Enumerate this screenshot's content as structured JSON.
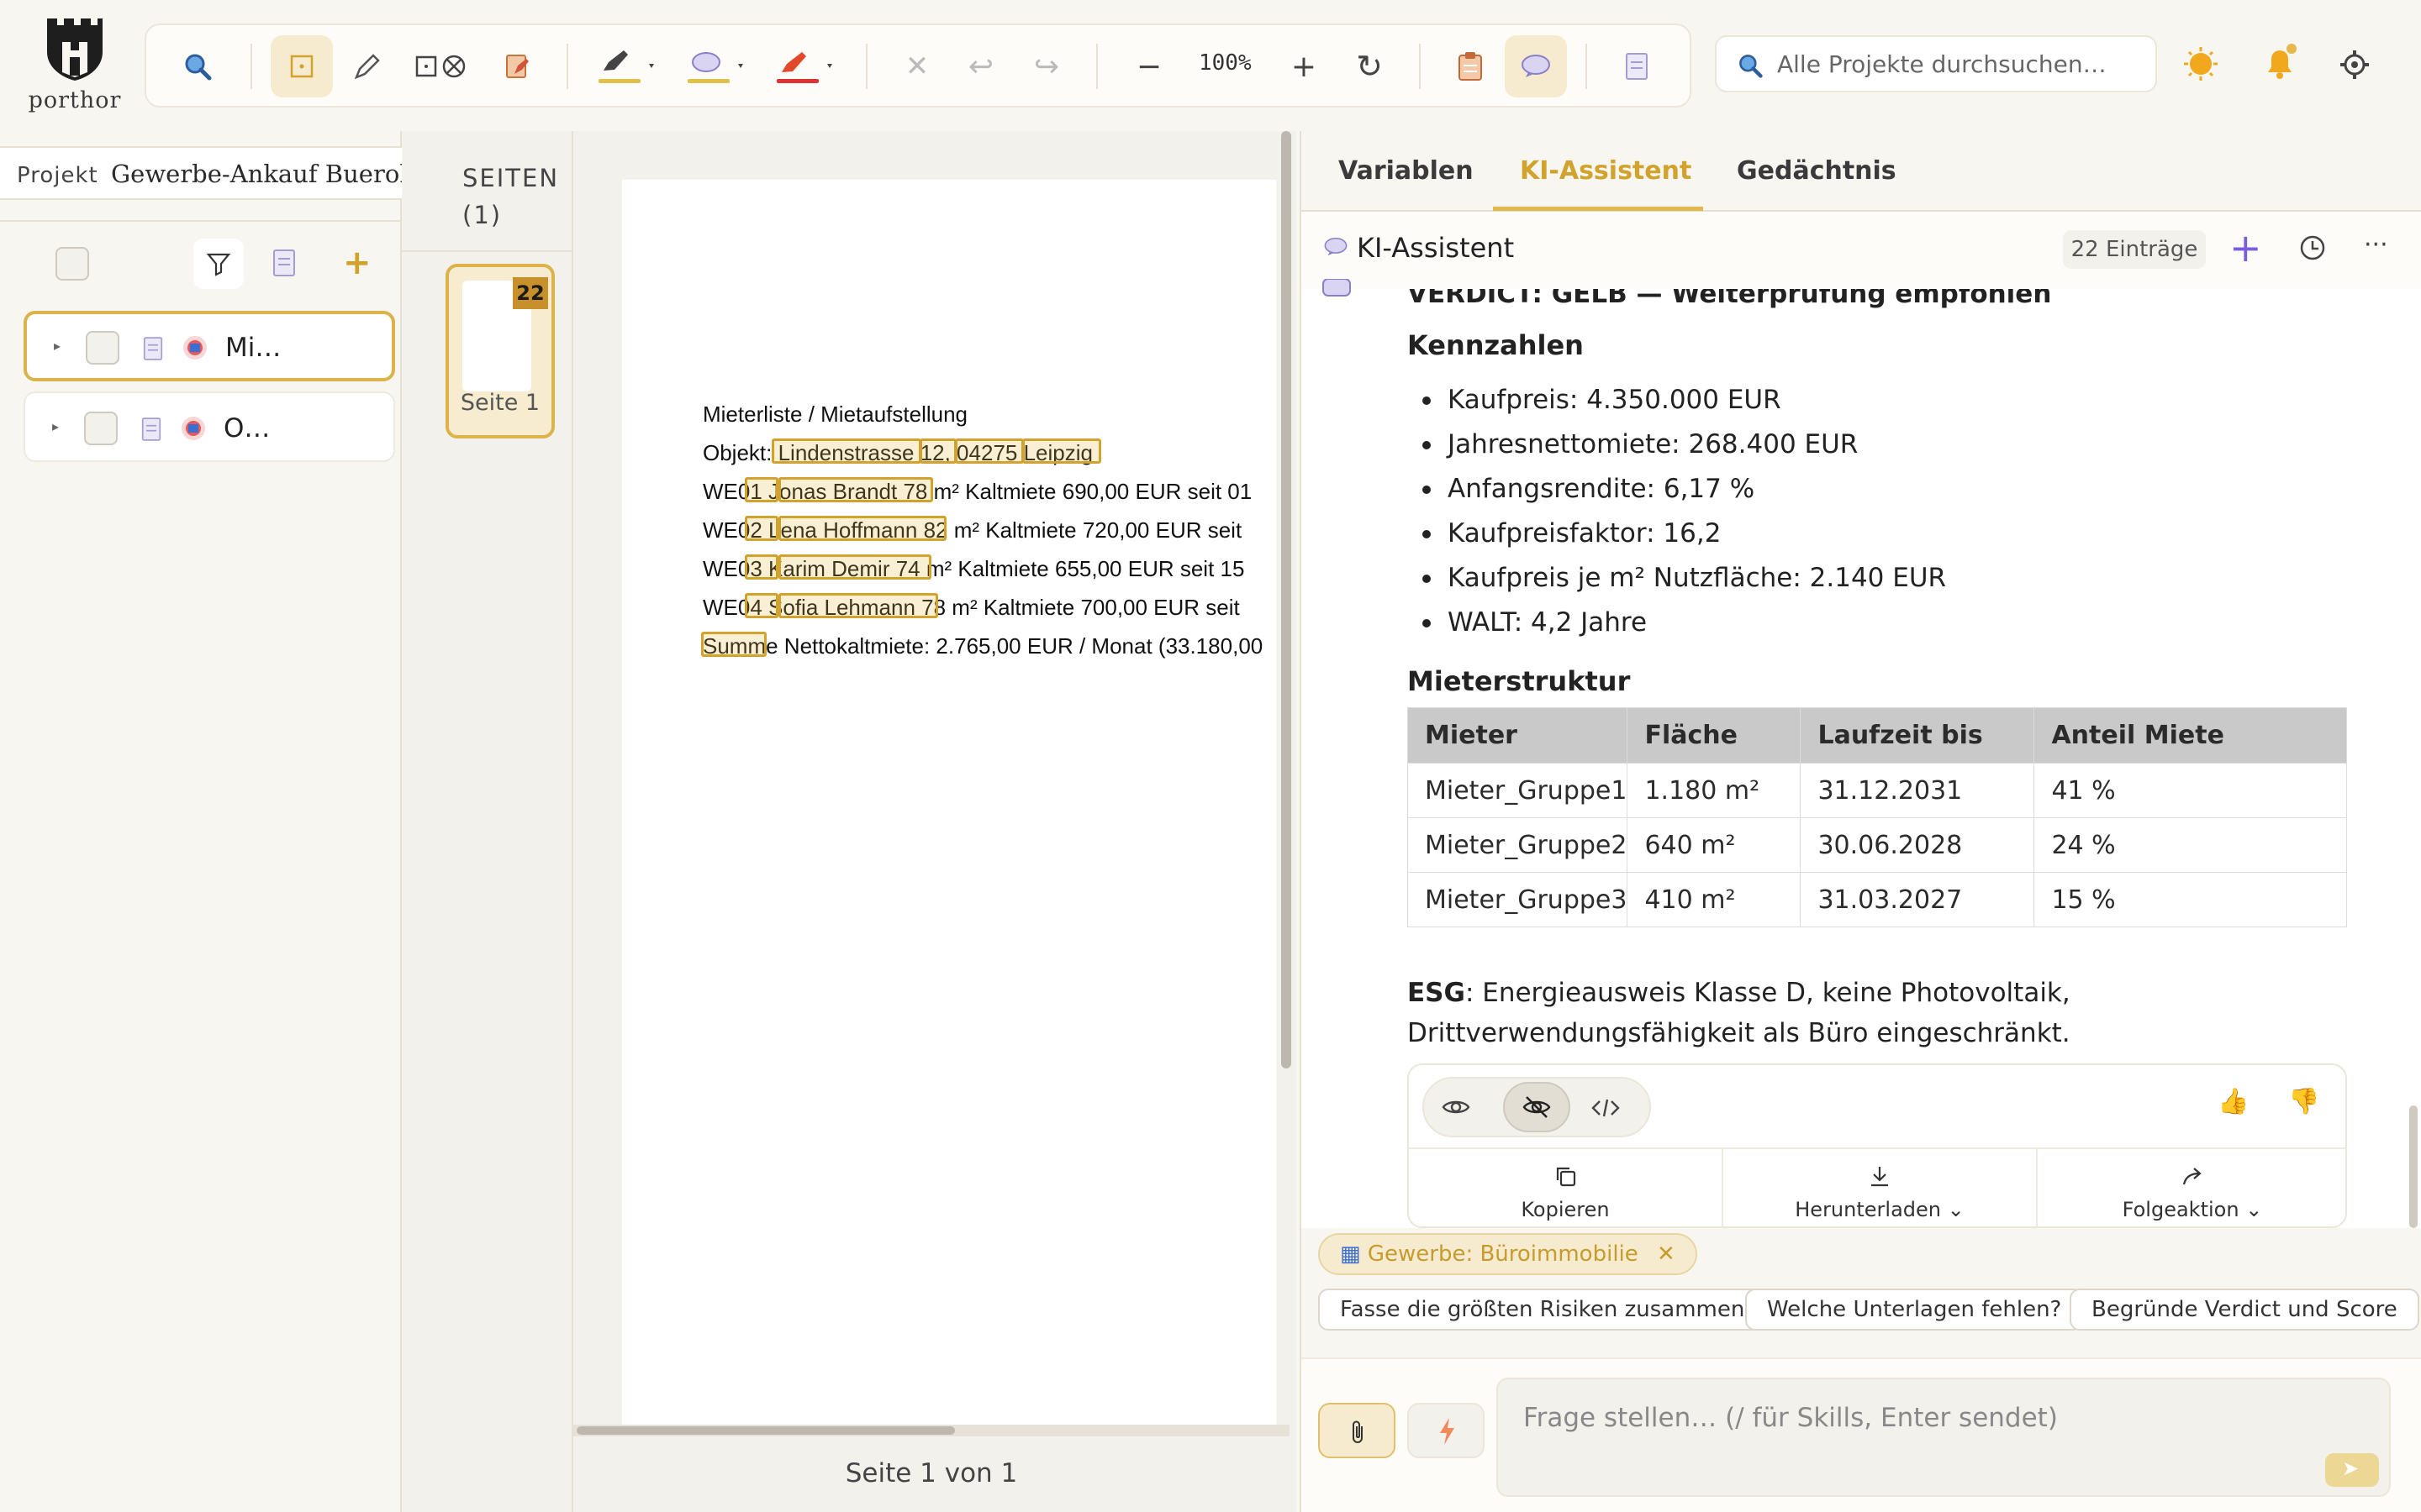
{
  "app": {
    "name": "porthor"
  },
  "toolbar": {
    "zoom": "100%"
  },
  "search": {
    "placeholder": "Alle Projekte durchsuchen…"
  },
  "project": {
    "label": "Projekt",
    "name": "Gewerbe-Ankauf Buerohaus"
  },
  "documents": [
    {
      "name": "Mi…"
    },
    {
      "name": "O…"
    }
  ],
  "pages": {
    "heading": "SEITEN",
    "count": "(1)",
    "thumb_label": "Seite 1",
    "badge": "22"
  },
  "viewer": {
    "page_counter": "Seite 1 von 1"
  },
  "document_lines": [
    "Mieterliste / Mietaufstellung",
    "Objekt: Lindenstrasse 12, 04275 Leipzig",
    "WE01  Jonas Brandt  78 m²  Kaltmiete 690,00 EUR  seit 01",
    "WE02  Lena Hoffmann  82 m²  Kaltmiete 720,00 EUR  seit",
    "WE03  Karim Demir  74 m²  Kaltmiete 655,00 EUR  seit 15",
    "WE04  Sofia Lehmann  78 m²  Kaltmiete 700,00 EUR  seit",
    "Summe Nettokaltmiete: 2.765,00 EUR / Monat  (33.180,00"
  ],
  "tabs": [
    "Variablen",
    "KI-Assistent",
    "Gedächtnis"
  ],
  "assistant": {
    "title": "KI-Assistent",
    "entries": "22 Einträge",
    "verdict": "VERDICT: GELB — Weiterprüfung empfohlen",
    "kennzahlen_heading": "Kennzahlen",
    "kennzahlen": [
      "Kaufpreis: 4.350.000 EUR",
      "Jahresnettomiete: 268.400 EUR",
      "Anfangsrendite: 6,17 %",
      "Kaufpreisfaktor: 16,2",
      "Kaufpreis je m² Nutzfläche: 2.140 EUR",
      "WALT: 4,2 Jahre"
    ],
    "mieter_heading": "Mieterstruktur",
    "table": {
      "headers": [
        "Mieter",
        "Fläche",
        "Laufzeit bis",
        "Anteil Miete"
      ],
      "rows": [
        [
          "Mieter_Gruppe1",
          "1.180 m²",
          "31.12.2031",
          "41 %"
        ],
        [
          "Mieter_Gruppe2",
          "640 m²",
          "30.06.2028",
          "24 %"
        ],
        [
          "Mieter_Gruppe3",
          "410 m²",
          "31.03.2027",
          "15 %"
        ]
      ]
    },
    "esg_label": "ESG",
    "esg_text": ": Energieausweis Klasse D, keine Photovoltaik, Drittverwendungsfähigkeit als Büro eingeschränkt.",
    "actions": {
      "copy": "Kopieren",
      "download": "Herunterladen",
      "followup": "Folgeaktion"
    }
  },
  "chips": {
    "category": "Gewerbe: Büroimmobilie",
    "suggestions": [
      "Fasse die größten Risiken zusammen",
      "Welche Unterlagen fehlen?",
      "Begründe Verdict und Score"
    ]
  },
  "input": {
    "placeholder": "Frage stellen… (/ für Skills, Enter sendet)"
  },
  "colors": {
    "accent": "#d2a32c",
    "highlight": "#dcb24a",
    "badge": "#c8902a",
    "background": "#f8f6f1"
  }
}
